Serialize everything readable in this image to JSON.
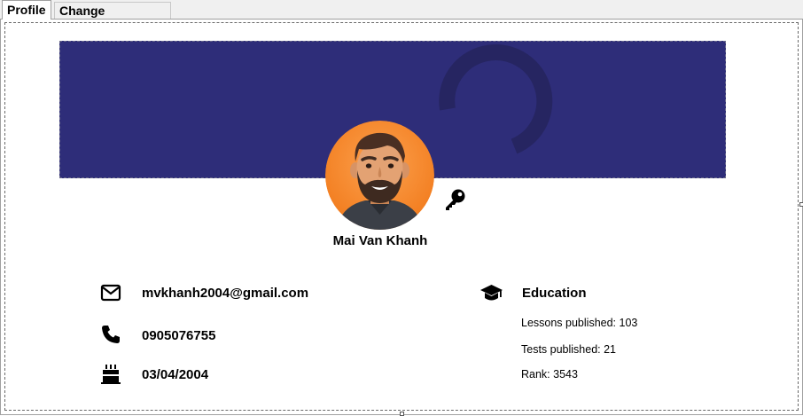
{
  "tabs": [
    {
      "label": "Profile",
      "active": true
    },
    {
      "label": "Change Password",
      "active": false
    }
  ],
  "colors": {
    "banner": "#2e2d79",
    "spinner": "#262561",
    "avatar_bg": "#f27d1f"
  },
  "profile": {
    "name": "Mai Van Khanh",
    "avatar_icon": "avatar-illustration",
    "edit_icon": "key-icon",
    "banner_icon": "loading-spinner-icon"
  },
  "contact": {
    "email": {
      "icon": "envelope-icon",
      "value": "mvkhanh2004@gmail.com"
    },
    "phone": {
      "icon": "phone-icon",
      "value": "0905076755"
    },
    "birthday": {
      "icon": "birthday-cake-icon",
      "value": "03/04/2004"
    }
  },
  "education": {
    "icon": "graduation-cap-icon",
    "title": "Education",
    "lessons": "Lessons published: 103",
    "tests": "Tests published: 21",
    "rank": "Rank: 3543"
  }
}
